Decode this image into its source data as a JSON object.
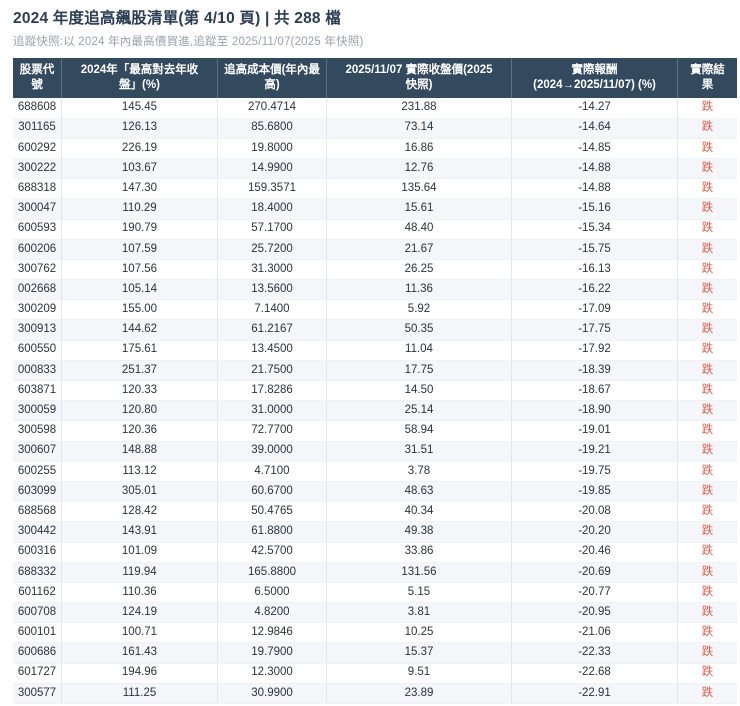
{
  "header": {
    "title": "2024 年度追高飆股清單(第 4/10 頁) | 共 288 檔",
    "subtitle": "追蹤快照:以 2024 年內最高價買進,追蹤至 2025/11/07(2025 年快照)"
  },
  "table": {
    "columns": [
      "股票代\n號",
      "2024年「最高對去年收\n盤」(%)",
      "追高成本價(年內最\n高)",
      "2025/11/07 實際收盤價(2025\n快照)",
      "實際報酬\n(2024→2025/11/07) (%)",
      "實際結\n果"
    ],
    "rows": [
      [
        "688608",
        "145.45",
        "270.4714",
        "231.88",
        "-14.27",
        "跌"
      ],
      [
        "301165",
        "126.13",
        "85.6800",
        "73.14",
        "-14.64",
        "跌"
      ],
      [
        "600292",
        "226.19",
        "19.8000",
        "16.86",
        "-14.85",
        "跌"
      ],
      [
        "300222",
        "103.67",
        "14.9900",
        "12.76",
        "-14.88",
        "跌"
      ],
      [
        "688318",
        "147.30",
        "159.3571",
        "135.64",
        "-14.88",
        "跌"
      ],
      [
        "300047",
        "110.29",
        "18.4000",
        "15.61",
        "-15.16",
        "跌"
      ],
      [
        "600593",
        "190.79",
        "57.1700",
        "48.40",
        "-15.34",
        "跌"
      ],
      [
        "600206",
        "107.59",
        "25.7200",
        "21.67",
        "-15.75",
        "跌"
      ],
      [
        "300762",
        "107.56",
        "31.3000",
        "26.25",
        "-16.13",
        "跌"
      ],
      [
        "002668",
        "105.14",
        "13.5600",
        "11.36",
        "-16.22",
        "跌"
      ],
      [
        "300209",
        "155.00",
        "7.1400",
        "5.92",
        "-17.09",
        "跌"
      ],
      [
        "300913",
        "144.62",
        "61.2167",
        "50.35",
        "-17.75",
        "跌"
      ],
      [
        "600550",
        "175.61",
        "13.4500",
        "11.04",
        "-17.92",
        "跌"
      ],
      [
        "000833",
        "251.37",
        "21.7500",
        "17.75",
        "-18.39",
        "跌"
      ],
      [
        "603871",
        "120.33",
        "17.8286",
        "14.50",
        "-18.67",
        "跌"
      ],
      [
        "300059",
        "120.80",
        "31.0000",
        "25.14",
        "-18.90",
        "跌"
      ],
      [
        "300598",
        "120.36",
        "72.7700",
        "58.94",
        "-19.01",
        "跌"
      ],
      [
        "300607",
        "148.88",
        "39.0000",
        "31.51",
        "-19.21",
        "跌"
      ],
      [
        "600255",
        "113.12",
        "4.7100",
        "3.78",
        "-19.75",
        "跌"
      ],
      [
        "603099",
        "305.01",
        "60.6700",
        "48.63",
        "-19.85",
        "跌"
      ],
      [
        "688568",
        "128.42",
        "50.4765",
        "40.34",
        "-20.08",
        "跌"
      ],
      [
        "300442",
        "143.91",
        "61.8800",
        "49.38",
        "-20.20",
        "跌"
      ],
      [
        "600316",
        "101.09",
        "42.5700",
        "33.86",
        "-20.46",
        "跌"
      ],
      [
        "688332",
        "119.94",
        "165.8800",
        "131.56",
        "-20.69",
        "跌"
      ],
      [
        "601162",
        "110.36",
        "6.5000",
        "5.15",
        "-20.77",
        "跌"
      ],
      [
        "600708",
        "124.19",
        "4.8200",
        "3.81",
        "-20.95",
        "跌"
      ],
      [
        "600101",
        "100.71",
        "12.9846",
        "10.25",
        "-21.06",
        "跌"
      ],
      [
        "600686",
        "161.43",
        "19.7900",
        "15.37",
        "-22.33",
        "跌"
      ],
      [
        "601727",
        "194.96",
        "12.3000",
        "9.51",
        "-22.68",
        "跌"
      ],
      [
        "300577",
        "111.25",
        "30.9900",
        "23.89",
        "-22.91",
        "跌"
      ]
    ],
    "result_down_label": "跌"
  },
  "colors": {
    "header_bg": "#33495e",
    "header_text": "#ffffff",
    "row_alt_bg": "#f4f6f9",
    "result_down_red": "#d95f4c",
    "title_text": "#2c3c52",
    "subtitle_text": "#99a2ac",
    "cell_border": "#e3e7ec"
  }
}
